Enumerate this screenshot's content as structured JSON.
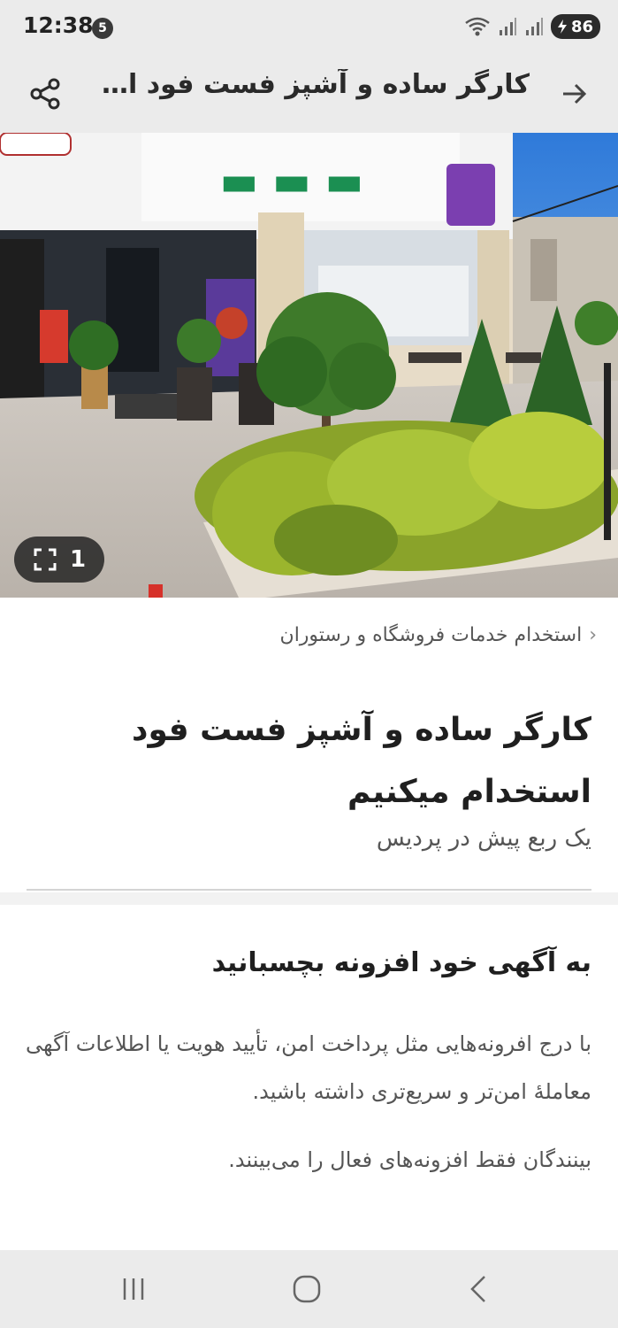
{
  "status_bar": {
    "time": "12:38",
    "notif_count": "5",
    "battery": "86"
  },
  "app_bar": {
    "title": "کارگر ساده و آشپز فست فود است..."
  },
  "gallery": {
    "count": "1"
  },
  "content": {
    "breadcrumb": "استخدام خدمات فروشگاه و رستوران",
    "title": "کارگر ساده و آشپز فست فود استخدام میکنیم",
    "meta": "یک ربع پیش در پردیس"
  },
  "promo": {
    "title": "به آگهی خود افزونه بچسبانید",
    "body": "با درج افرونه‌هایی مثل پرداخت امن، تأیید هویت یا اطلاعات آگهی معاملهٔ امن‌تر و سریع‌تری داشته باشید.",
    "note": "بینندگان فقط افزونه‌های فعال را می‌بینند."
  },
  "icons": {
    "back": "arrow-right-icon",
    "share": "share-icon",
    "expand": "fullscreen-icon",
    "recents": "recents-icon",
    "home": "home-icon",
    "nav_back": "nav-back-icon"
  }
}
